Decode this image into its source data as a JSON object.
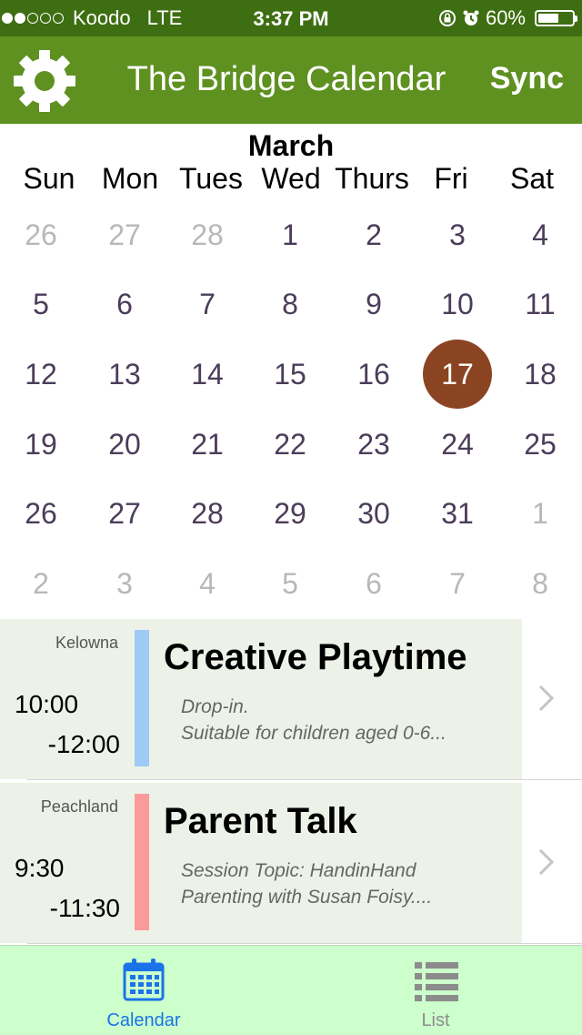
{
  "status_bar": {
    "carrier": "Koodo",
    "network": "LTE",
    "time": "3:37 PM",
    "battery": "60%",
    "battery_level": 0.6,
    "signal_bars_filled": 2,
    "signal_bars_total": 5
  },
  "nav": {
    "title": "The Bridge Calendar",
    "sync_label": "Sync",
    "settings_icon": "gear-icon"
  },
  "calendar": {
    "month": "March",
    "weekdays": [
      "Sun",
      "Mon",
      "Tues",
      "Wed",
      "Thurs",
      "Fri",
      "Sat"
    ],
    "selected_day": "17",
    "weeks": [
      [
        {
          "d": "26",
          "m": true
        },
        {
          "d": "27",
          "m": true
        },
        {
          "d": "28",
          "m": true
        },
        {
          "d": "1"
        },
        {
          "d": "2"
        },
        {
          "d": "3"
        },
        {
          "d": "4"
        }
      ],
      [
        {
          "d": "5"
        },
        {
          "d": "6"
        },
        {
          "d": "7"
        },
        {
          "d": "8"
        },
        {
          "d": "9"
        },
        {
          "d": "10"
        },
        {
          "d": "11"
        }
      ],
      [
        {
          "d": "12"
        },
        {
          "d": "13"
        },
        {
          "d": "14"
        },
        {
          "d": "15"
        },
        {
          "d": "16"
        },
        {
          "d": "17",
          "s": true
        },
        {
          "d": "18"
        }
      ],
      [
        {
          "d": "19"
        },
        {
          "d": "20"
        },
        {
          "d": "21"
        },
        {
          "d": "22"
        },
        {
          "d": "23"
        },
        {
          "d": "24"
        },
        {
          "d": "25"
        }
      ],
      [
        {
          "d": "26"
        },
        {
          "d": "27"
        },
        {
          "d": "28"
        },
        {
          "d": "29"
        },
        {
          "d": "30"
        },
        {
          "d": "31"
        },
        {
          "d": "1",
          "m": true
        }
      ],
      [
        {
          "d": "2",
          "m": true
        },
        {
          "d": "3",
          "m": true
        },
        {
          "d": "4",
          "m": true
        },
        {
          "d": "5",
          "m": true
        },
        {
          "d": "6",
          "m": true
        },
        {
          "d": "7",
          "m": true
        },
        {
          "d": "8",
          "m": true
        }
      ]
    ]
  },
  "events": [
    {
      "location": "Kelowna",
      "start": "10:00",
      "end": "-12:00",
      "title": "Creative Playtime",
      "desc_line1": "Drop-in.",
      "desc_line2": "Suitable for children aged 0-6...",
      "color": "#9fcaf5"
    },
    {
      "location": "Peachland",
      "start": "9:30",
      "end": "-11:30",
      "title": "Parent Talk",
      "desc_line1": "Session Topic: HandinHand",
      "desc_line2": "Parenting with Susan Foisy....",
      "color": "#fb9a9a"
    }
  ],
  "tabs": [
    {
      "label": "Calendar",
      "icon": "calendar-icon",
      "active": true,
      "color": "#1a73e8"
    },
    {
      "label": "List",
      "icon": "list-icon",
      "active": false,
      "color": "#8c8c8c"
    }
  ],
  "colors": {
    "status_bar": "#3e6e12",
    "nav_bar": "#5f9121",
    "selected_day": "#8b4422",
    "event_card": "#edf2e8",
    "tab_bar": "#ccffcc"
  }
}
